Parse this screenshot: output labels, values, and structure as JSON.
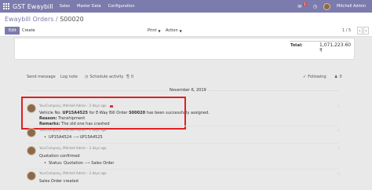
{
  "topbar": {
    "app_name": "GST Ewaybill",
    "menu": [
      "Sales",
      "Master Data",
      "Configuration"
    ],
    "user": "Mitchell Admin",
    "notification_count": "1",
    "color": "#7c7bad"
  },
  "control": {
    "breadcrumb_parent": "Ewaybill Orders",
    "breadcrumb_sep": " / ",
    "breadcrumb_current": "S00020",
    "edit_label": "Edit",
    "create_label": "Create",
    "print_label": "Print",
    "action_label": "Action",
    "pager": "1 / 5"
  },
  "sheet": {
    "total_label": "Total:",
    "total_value": "1,071,223.60 ₹"
  },
  "chatter": {
    "send_message": "Send message",
    "log_note": "Log note",
    "schedule_activity": "Schedule activity",
    "attachments": "0",
    "following": "Following",
    "followers": "0",
    "date": "November 6, 2019"
  },
  "messages": [
    {
      "author": "YourCompany, Mitchell Admin - 2 days ago",
      "line1_prefix": "Vehicle No: ",
      "line1_vehicle": "UP15A4525",
      "line1_mid": " for E-Way Bill Order ",
      "line1_order": "S00020",
      "line1_suffix": " has been successfully assigned.",
      "reason_label": "Reason:",
      "reason_value": " Transhipment",
      "remarks_label": "Remarks:",
      "remarks_value": " The old one has crashed"
    },
    {
      "author": "YourCompany, Mitchell Admin - 2 days ago",
      "change_from": "UP15A4524",
      "change_to": "UP15A4525"
    },
    {
      "author": "YourCompany, Mitchell Admin - 2 days ago",
      "text": "Quotation confirmed",
      "status_label": "Status: Quotation",
      "status_to": "Sales Order"
    },
    {
      "author": "YourCompany, Mitchell Admin - 2 days ago",
      "text": "Sales Order created"
    }
  ]
}
